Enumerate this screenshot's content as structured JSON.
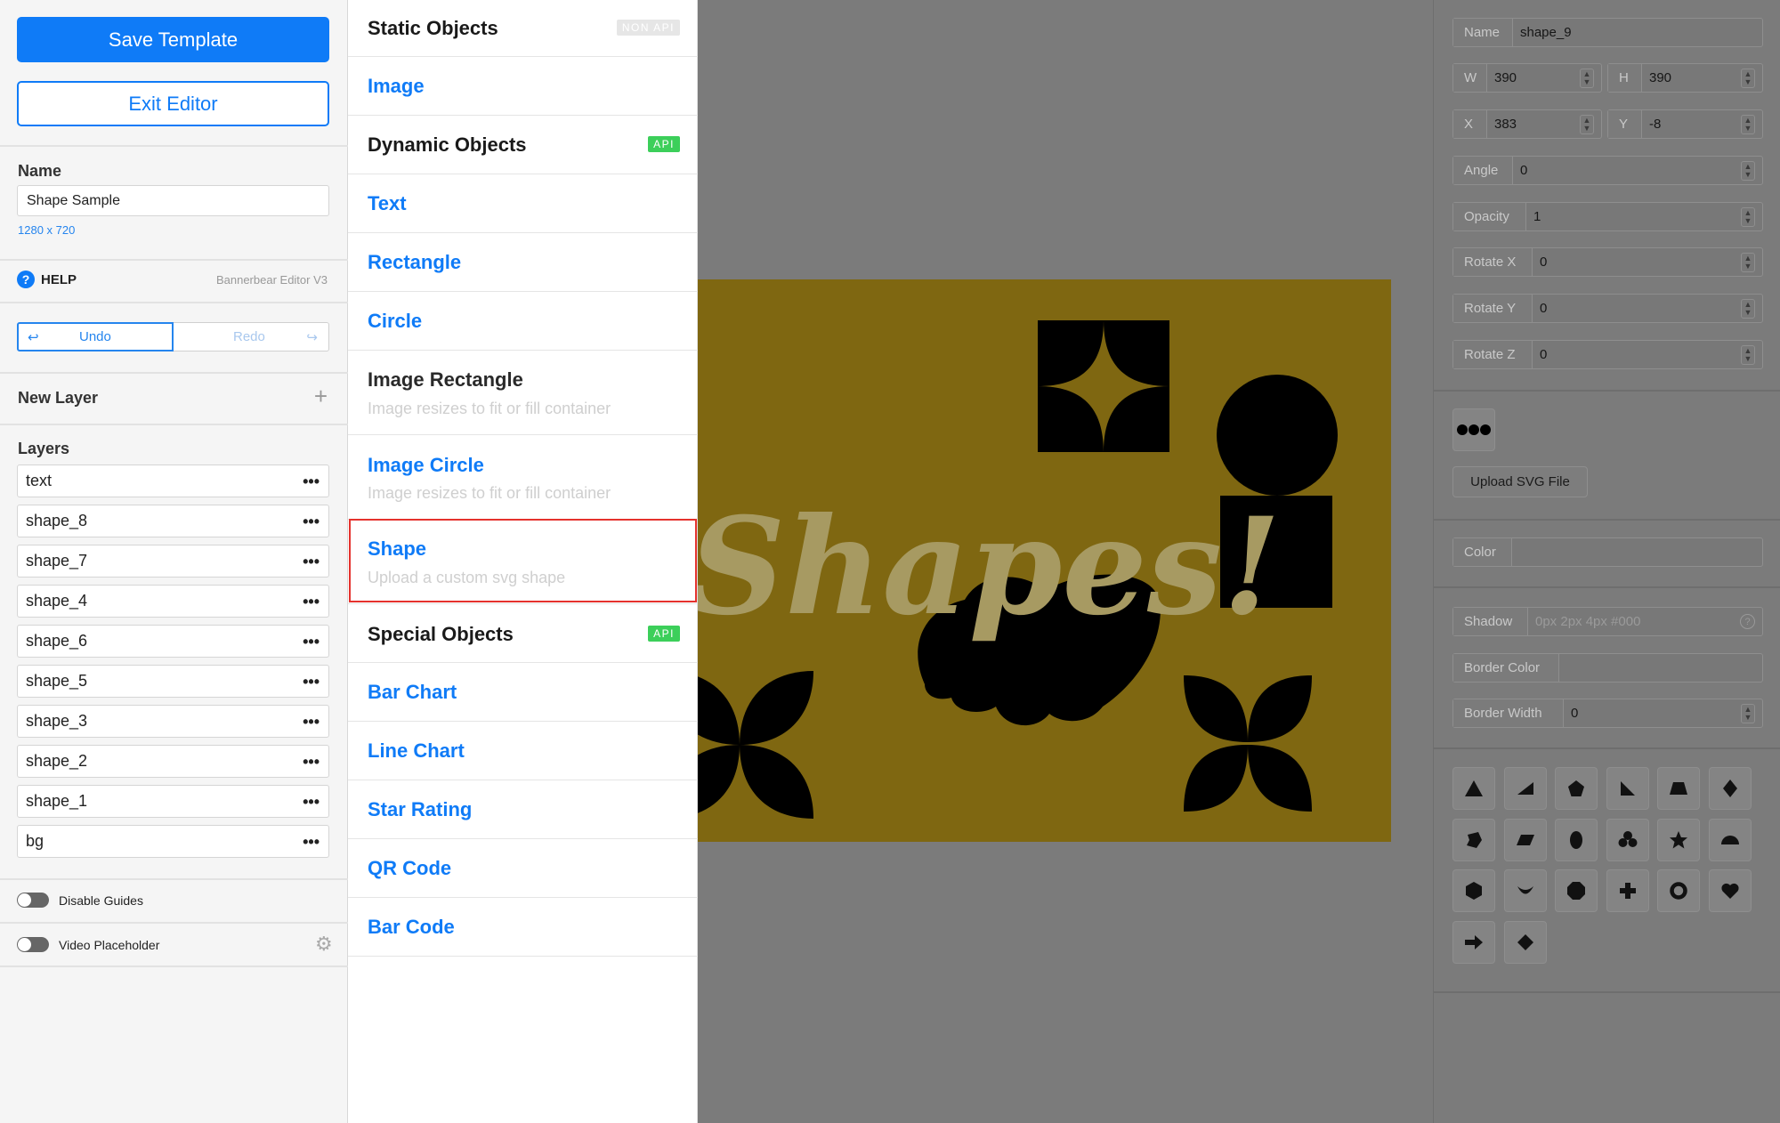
{
  "sidebar": {
    "save_label": "Save Template",
    "exit_label": "Exit Editor",
    "name_label": "Name",
    "name_value": "Shape Sample",
    "dimensions": "1280 x 720",
    "help_label": "HELP",
    "editor_version": "Bannerbear Editor V3",
    "undo_label": "Undo",
    "redo_label": "Redo",
    "new_layer_label": "New Layer",
    "layers_label": "Layers",
    "layers": [
      "text",
      "shape_8",
      "shape_7",
      "shape_4",
      "shape_6",
      "shape_5",
      "shape_3",
      "shape_2",
      "shape_1",
      "bg"
    ],
    "layer_menu_icon": "•••",
    "disable_guides_label": "Disable Guides",
    "video_placeholder_label": "Video Placeholder"
  },
  "objects": {
    "static_heading": "Static Objects",
    "static_tag": "NON API",
    "image": "Image",
    "dynamic_heading": "Dynamic Objects",
    "dynamic_tag": "API",
    "text": "Text",
    "rectangle": "Rectangle",
    "circle": "Circle",
    "image_rectangle": "Image Rectangle",
    "image_rectangle_sub": "Image resizes to fit or fill container",
    "image_circle": "Image Circle",
    "image_circle_sub": "Image resizes to fit or fill container",
    "shape": "Shape",
    "shape_sub": "Upload a custom svg shape",
    "special_heading": "Special Objects",
    "special_tag": "API",
    "bar_chart": "Bar Chart",
    "line_chart": "Line Chart",
    "star_rating": "Star Rating",
    "qr_code": "QR Code",
    "bar_code": "Bar Code"
  },
  "canvas": {
    "text": "Shapes!",
    "background_color": "#7f6711",
    "text_color": "#a79a62"
  },
  "properties": {
    "name_label": "Name",
    "name_value": "shape_9",
    "w_label": "W",
    "w_value": "390",
    "h_label": "H",
    "h_value": "390",
    "x_label": "X",
    "x_value": "383",
    "y_label": "Y",
    "y_value": "-8",
    "angle_label": "Angle",
    "angle_value": "0",
    "opacity_label": "Opacity",
    "opacity_value": "1",
    "rotate_x_label": "Rotate X",
    "rotate_x_value": "0",
    "rotate_y_label": "Rotate Y",
    "rotate_y_value": "0",
    "rotate_z_label": "Rotate Z",
    "rotate_z_value": "0",
    "upload_label": "Upload SVG File",
    "color_label": "Color",
    "color_value": "",
    "shadow_label": "Shadow",
    "shadow_placeholder": "0px 2px 4px #000",
    "border_color_label": "Border Color",
    "border_color_value": "",
    "border_width_label": "Border Width",
    "border_width_value": "0",
    "shape_icons": [
      "triangle-icon",
      "right-triangle-icon",
      "pentagon-icon",
      "corner-triangle-icon",
      "trapezoid-icon",
      "diamond-icon",
      "blob-icon",
      "parallelogram-icon",
      "ellipse-icon",
      "club-icon",
      "star-icon",
      "semicircle-icon",
      "hexagon-icon",
      "crescent-icon",
      "octagon-icon",
      "cross-icon",
      "ring-icon",
      "heart-icon",
      "arrow-icon",
      "rhombus-icon"
    ]
  },
  "colors": {
    "accent": "#0f7bf7",
    "api_tag": "#3ccf5a",
    "highlight": "#e5322d"
  }
}
